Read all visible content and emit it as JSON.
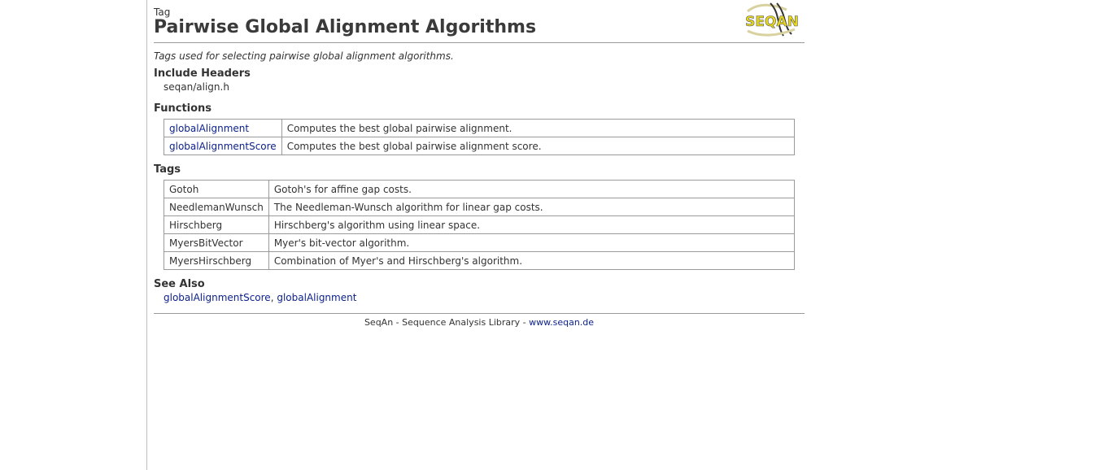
{
  "header": {
    "kind": "Tag",
    "title": "Pairwise Global Alignment Algorithms",
    "logo_text": "SEQAN"
  },
  "description": "Tags used for selecting pairwise global alignment algorithms.",
  "include_headers": {
    "heading": "Include Headers",
    "file": "seqan/align.h"
  },
  "functions": {
    "heading": "Functions",
    "rows": [
      {
        "name": "globalAlignment",
        "desc": "Computes the best global pairwise alignment."
      },
      {
        "name": "globalAlignmentScore",
        "desc": "Computes the best global pairwise alignment score."
      }
    ]
  },
  "tags": {
    "heading": "Tags",
    "rows": [
      {
        "name": "Gotoh",
        "desc": "Gotoh's for affine gap costs."
      },
      {
        "name": "NeedlemanWunsch",
        "desc": "The Needleman-Wunsch algorithm for linear gap costs."
      },
      {
        "name": "Hirschberg",
        "desc": "Hirschberg's algorithm using linear space."
      },
      {
        "name": "MyersBitVector",
        "desc": "Myer's bit-vector algorithm."
      },
      {
        "name": "MyersHirschberg",
        "desc": "Combination of Myer's and Hirschberg's algorithm."
      }
    ]
  },
  "see_also": {
    "heading": "See Also",
    "links": [
      "globalAlignmentScore",
      "globalAlignment"
    ],
    "separator": ", "
  },
  "footer": {
    "text": "SeqAn - Sequence Analysis Library - ",
    "link": "www.seqan.de"
  },
  "colors": {
    "link": "#0b1f8a",
    "logo_yellow": "#e6d81c",
    "rule": "#9a9a9a"
  }
}
